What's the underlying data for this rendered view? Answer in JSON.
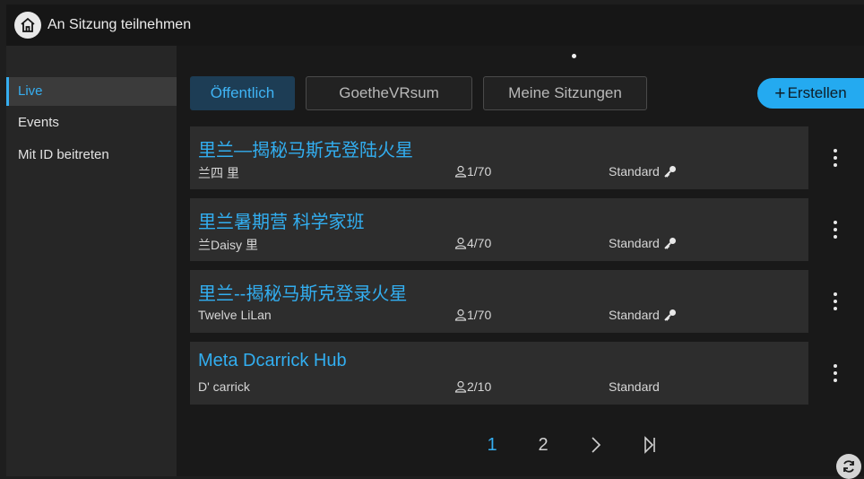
{
  "header": {
    "title": "An Sitzung teilnehmen",
    "home_icon": "home-icon"
  },
  "sidebar": {
    "items": [
      {
        "label": "Live",
        "active": true
      },
      {
        "label": "Events",
        "active": false
      },
      {
        "label": "Mit ID beitreten",
        "active": false
      }
    ]
  },
  "tabs": [
    {
      "label": "Öffentlich",
      "active": true
    },
    {
      "label": "GoetheVRsum",
      "active": false
    },
    {
      "label": "Meine Sitzungen",
      "active": false
    }
  ],
  "create_button": {
    "label": "Erstellen",
    "icon": "plus-icon"
  },
  "sessions": [
    {
      "title": "里兰—揭秘马斯克登陆火星",
      "owner": "兰四 里",
      "users": "1/70",
      "type": "Standard",
      "locked": true
    },
    {
      "title": "里兰暑期营 科学家班",
      "owner": "兰Daisy 里",
      "users": "4/70",
      "type": "Standard",
      "locked": true
    },
    {
      "title": "里兰--揭秘马斯克登录火星",
      "owner": "Twelve LiLan",
      "users": "1/70",
      "type": "Standard",
      "locked": true
    },
    {
      "title": "Meta Dcarrick Hub",
      "owner": "D' carrick",
      "users": "2/10",
      "type": "Standard",
      "locked": false
    }
  ],
  "pagination": {
    "pages": [
      "1",
      "2"
    ],
    "current": "1",
    "next_icon": "chevron-right-icon",
    "last_icon": "skip-to-last-icon"
  },
  "colors": {
    "accent": "#32aef0",
    "background": "#191919",
    "card": "#2d2d2d"
  }
}
